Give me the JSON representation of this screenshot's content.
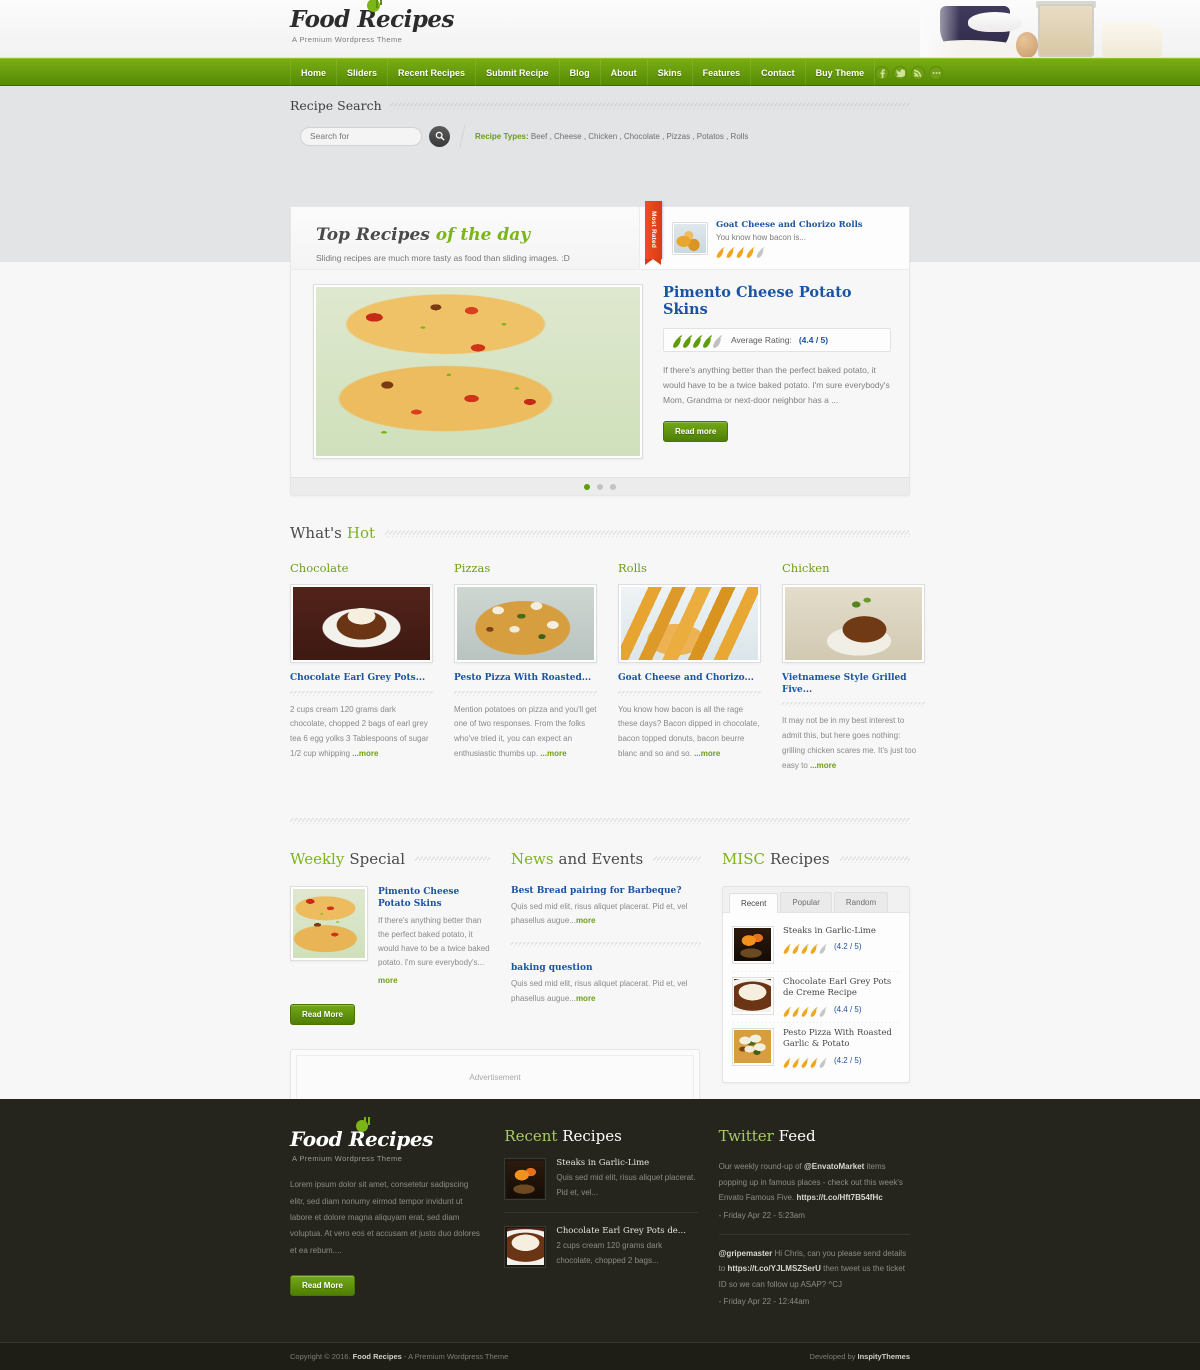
{
  "brand": {
    "name": "Food Recipes",
    "tagline": "A Premium Wordpress Theme",
    "accent_green": "#7cb518",
    "link_blue": "#1b54a2",
    "ribbon_red": "#f04e23"
  },
  "nav": {
    "items": [
      {
        "label": "Home"
      },
      {
        "label": "Sliders"
      },
      {
        "label": "Recent Recipes"
      },
      {
        "label": "Submit Recipe"
      },
      {
        "label": "Blog"
      },
      {
        "label": "About"
      },
      {
        "label": "Skins"
      },
      {
        "label": "Features"
      },
      {
        "label": "Contact"
      },
      {
        "label": "Buy Theme"
      }
    ],
    "social": [
      {
        "icon": "facebook-icon",
        "glyph": "f"
      },
      {
        "icon": "twitter-icon",
        "glyph": "t"
      },
      {
        "icon": "rss-icon",
        "glyph": "r"
      },
      {
        "icon": "more-dots-icon",
        "glyph": "••"
      }
    ]
  },
  "search": {
    "heading": "Recipe Search",
    "placeholder": "Search for",
    "value": "",
    "button_icon": "search-icon",
    "recipe_types_label": "Recipe Types:",
    "recipe_types": "Beef , Cheese , Chicken , Chocolate , Pizzas , Potatos , Rolls"
  },
  "slider": {
    "title_dark": "Top Recipes",
    "title_green": "of the day",
    "subtitle": "Sliding recipes are much more tasty as food than sliding images. :D",
    "most_rated": {
      "ribbon": "Most Rated",
      "title": "Goat Cheese and Chorizo Rolls",
      "excerpt": "You know how bacon is...",
      "rating_filled": 4,
      "rating_total": 5
    },
    "featured": {
      "title": "Pimento Cheese Potato Skins",
      "rating_label": "Average Rating:",
      "rating_value": "(4.4 / 5)",
      "rating_filled": 4,
      "rating_total": 5,
      "excerpt": "If there's anything better than the perfect baked potato, it would have to be a twice baked potato. I'm sure everybody's Mom, Grandma or next-door neighbor has a ...",
      "button": "Read more"
    },
    "pagination": {
      "total": 3,
      "active": 1
    }
  },
  "whats_hot": {
    "title_dark": "What's",
    "title_green": "Hot",
    "cards": [
      {
        "category": "Chocolate",
        "image": "chocolate-mousse-cup-photo",
        "title": "Chocolate Earl Grey Pots...",
        "excerpt": "2 cups cream 120 grams dark chocolate, chopped 2 bags of earl grey tea 6 egg yolks 3 Tablespoons of sugar 1/2 cup whipping ",
        "more": "...more"
      },
      {
        "category": "Pizzas",
        "image": "pesto-pizza-photo",
        "title": "Pesto Pizza With Roasted...",
        "excerpt": "Mention potatoes on pizza and you'll get one of two responses. From the folks who've tried it, you can expect an enthusiastic thumbs up. ",
        "more": "...more"
      },
      {
        "category": "Rolls",
        "image": "chorizo-rolls-photo",
        "title": "Goat Cheese and Chorizo...",
        "excerpt": "You know how bacon is all the rage these days? Bacon dipped in chocolate, bacon topped donuts, bacon beurre blanc and so and so. ",
        "more": "...more"
      },
      {
        "category": "Chicken",
        "image": "grilled-chicken-photo",
        "title": "Vietnamese Style Grilled Five...",
        "excerpt": "It may not be in my best interest to admit this, but here goes nothing: grilling chicken scares me. It's just too easy to ",
        "more": "...more"
      }
    ]
  },
  "weekly_special": {
    "title_green": "Weekly",
    "title_dark": "Special",
    "item": {
      "image": "pimento-potato-skins-photo",
      "title": "Pimento Cheese Potato Skins",
      "excerpt": "If there's anything better than the perfect baked potato, it would have to be a twice baked potato. I'm sure everybody's...",
      "more": "more"
    },
    "button": "Read More"
  },
  "news": {
    "title_green": "News",
    "title_dark": "and Events",
    "items": [
      {
        "title": "Best Bread pairing for Barbeque?",
        "excerpt": "Quis sed mid elit, risus aliquet placerat. Pid et, vel phasellus augue...",
        "more": "more"
      },
      {
        "title": "baking question",
        "excerpt": "Quis sed mid elit, risus aliquet placerat. Pid et, vel phasellus augue...",
        "more": "more"
      }
    ]
  },
  "misc": {
    "title_green": "MISC",
    "title_dark": "Recipes",
    "tabs": [
      {
        "label": "Recent",
        "active": true
      },
      {
        "label": "Popular",
        "active": false
      },
      {
        "label": "Random",
        "active": false
      }
    ],
    "items": [
      {
        "image": "steaks-garlic-lime-photo",
        "title": "Steaks in Garlic-Lime",
        "rating": "(4.2 / 5)",
        "rating_filled": 4
      },
      {
        "image": "chocolate-pots-photo",
        "title": "Chocolate Earl Grey Pots de Creme Recipe",
        "rating": "(4.4 / 5)",
        "rating_filled": 4
      },
      {
        "image": "pesto-pizza-photo",
        "title": "Pesto Pizza With Roasted Garlic & Potato",
        "rating": "(4.2 / 5)",
        "rating_filled": 4
      }
    ]
  },
  "advertisement": {
    "label": "Advertisement"
  },
  "footer": {
    "about": {
      "logo": "Food Recipes",
      "tagline": "A Premium Wordpress Theme",
      "text": "Lorem ipsum dolor sit amet, consetetur sadipscing elitr, sed diam nonumy eirmod tempor invidunt ut labore et dolore magna aliquyam erat, sed diam voluptua. At vero eos et accusam et justo duo dolores et ea rebum....",
      "button": "Read More"
    },
    "recent": {
      "title_green": "Recent",
      "title_white": "Recipes",
      "items": [
        {
          "image": "steaks-garlic-lime-photo",
          "title": "Steaks in Garlic-Lime",
          "excerpt": "Quis sed mid elit, risus aliquet placerat. Pid et, vel..."
        },
        {
          "image": "chocolate-pots-photo",
          "title": "Chocolate Earl Grey Pots de...",
          "excerpt": "2 cups cream 120 grams dark chocolate, chopped 2 bags..."
        }
      ]
    },
    "twitter": {
      "title_green": "Twitter",
      "title_white": "Feed",
      "tweets": [
        {
          "pre": "Our weekly round-up of ",
          "handle": "@EnvatoMarket",
          "mid": " items popping up in famous places - check out this week's Envato Famous Five. ",
          "link": "https://t.co/Hft7B54fHc",
          "post": "",
          "date": "- Friday Apr 22 - 5:23am"
        },
        {
          "pre": "",
          "handle": "@gripemaster",
          "mid": " Hi Chris, can you please send details to ",
          "link": "https://t.co/YJLMSZSerU",
          "post": " then tweet us the ticket ID so we can follow up ASAP? ^CJ",
          "date": "- Friday Apr 22 - 12:44am"
        }
      ]
    },
    "copyright": {
      "prefix": "Copyright © 2016. ",
      "brand": "Food Recipes",
      "suffix": " - A Premium Wordpress Theme",
      "dev_prefix": "Developed by ",
      "dev_name": "InspityThemes"
    }
  }
}
